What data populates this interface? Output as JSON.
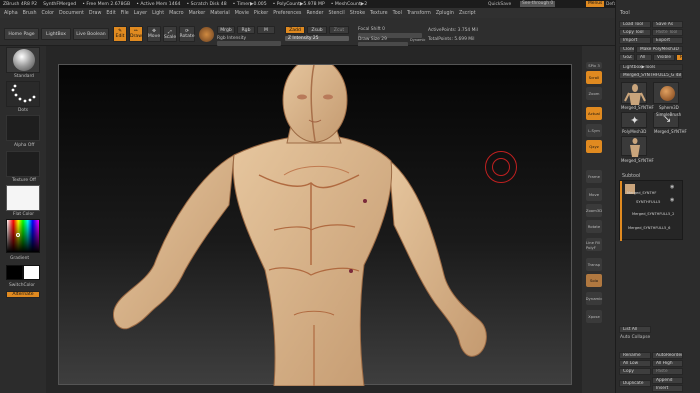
{
  "title_bar": {
    "app": "ZBrush 4R8 P2",
    "doc": "SynthFMerged",
    "free_mem": "• Free Mem 2.678GB",
    "active_mem": "• Active Mem 1464",
    "scratch": "• Scratch Disk 48",
    "timer": "• Timer▶0.005",
    "polycount": "• PolyCount▶5.978 MP",
    "meshcount": "• MeshCount▶2",
    "quicksave": "QuickSave",
    "see_through": "See-through  0",
    "menus": "Menus",
    "default_script": "DefaultZScript"
  },
  "menubar": [
    "Alpha",
    "Brush",
    "Color",
    "Document",
    "Draw",
    "Edit",
    "File",
    "Layer",
    "Light",
    "Macro",
    "Marker",
    "Material",
    "Movie",
    "Picker",
    "Preferences",
    "Render",
    "Stencil",
    "Stroke",
    "Texture",
    "Tool",
    "Transform",
    "Zplugin",
    "Zscript"
  ],
  "toolbar": {
    "home_page": "Home Page",
    "lightbox": "LightBox",
    "live_boolean": "Live Boolean",
    "edit": "Edit",
    "draw": "Draw",
    "move": "Move",
    "scale": "Scale",
    "rotate": "Rotate",
    "mrgb": "Mrgb",
    "rgb": "Rgb",
    "m": "M",
    "zadd": "Zadd",
    "zsub": "Zsub",
    "zcut": "Zcut",
    "rgb_intensity": "Rgb Intensity",
    "z_intensity": "Z Intensity 25",
    "focal_shift": "Focal Shift 0",
    "draw_size": "Draw Size 29",
    "dynamic": "Dynamic",
    "active_points": "ActivePoints: 3.754 Mil",
    "total_points": "TotalPoints: 5.699 Mil"
  },
  "left_panel": {
    "standard": "Standard",
    "dots": "Dots",
    "alpha_off": "Alpha Off",
    "texture_off": "Texture Off",
    "flat_color": "Flat Color",
    "gradient": "Gradient",
    "switch_color": "SwitchColor",
    "alternate": "Alternate"
  },
  "right_tools": [
    "SPix 3",
    "Scroll",
    "Zoom",
    "Actual",
    "AAHalf",
    "Persp",
    "Floor",
    "L.Sym",
    "Qxyz",
    "Frame",
    "Move",
    "Zoom3D",
    "Rotate",
    "Line Fill PolyF",
    "Transp",
    "Solo",
    "Dynamic",
    "Xpose"
  ],
  "tool_tray": {
    "header": "Tool",
    "load_tool": "Load Tool",
    "save_as": "Save As",
    "copy_tool": "Copy Tool",
    "paste_tool": "Paste Tool",
    "import": "Import",
    "export": "Export",
    "clone": "Clone",
    "make_polymesh": "Make PolyMesh3D",
    "goz": "GoZ",
    "all": "All",
    "visible": "Visible",
    "r": "R",
    "lightbox_tools": "Lightbox▶Tools",
    "current_tool": "Merged_SYNTHFULL5_G 48",
    "thumbs": [
      "Merged_SYNTHF",
      "Sphere3D",
      "PolyMesh3D",
      "SimpleBrush",
      "Merged_SYNTHF",
      "Merged_SYNTHF"
    ],
    "subtool_header": "Subtool",
    "subtools": [
      "Merged_SYNTHF",
      "SYNTHFULL5",
      "Merged_SYNTHFULL5_2",
      "Merged_SYNTHFULL5_6"
    ],
    "list_all": "List All",
    "auto_collapse": "Auto Collapse",
    "rename": "Rename",
    "auto_reorder": "AutoReorder",
    "all_low": "All Low",
    "all_high": "All High",
    "copy": "Copy",
    "paste": "Paste",
    "duplicate": "Duplicate",
    "append": "Append",
    "insert": "Insert"
  },
  "colors": {
    "accent": "#e08a20",
    "background": "#2a2a2a",
    "skin": "#d8b48c"
  }
}
